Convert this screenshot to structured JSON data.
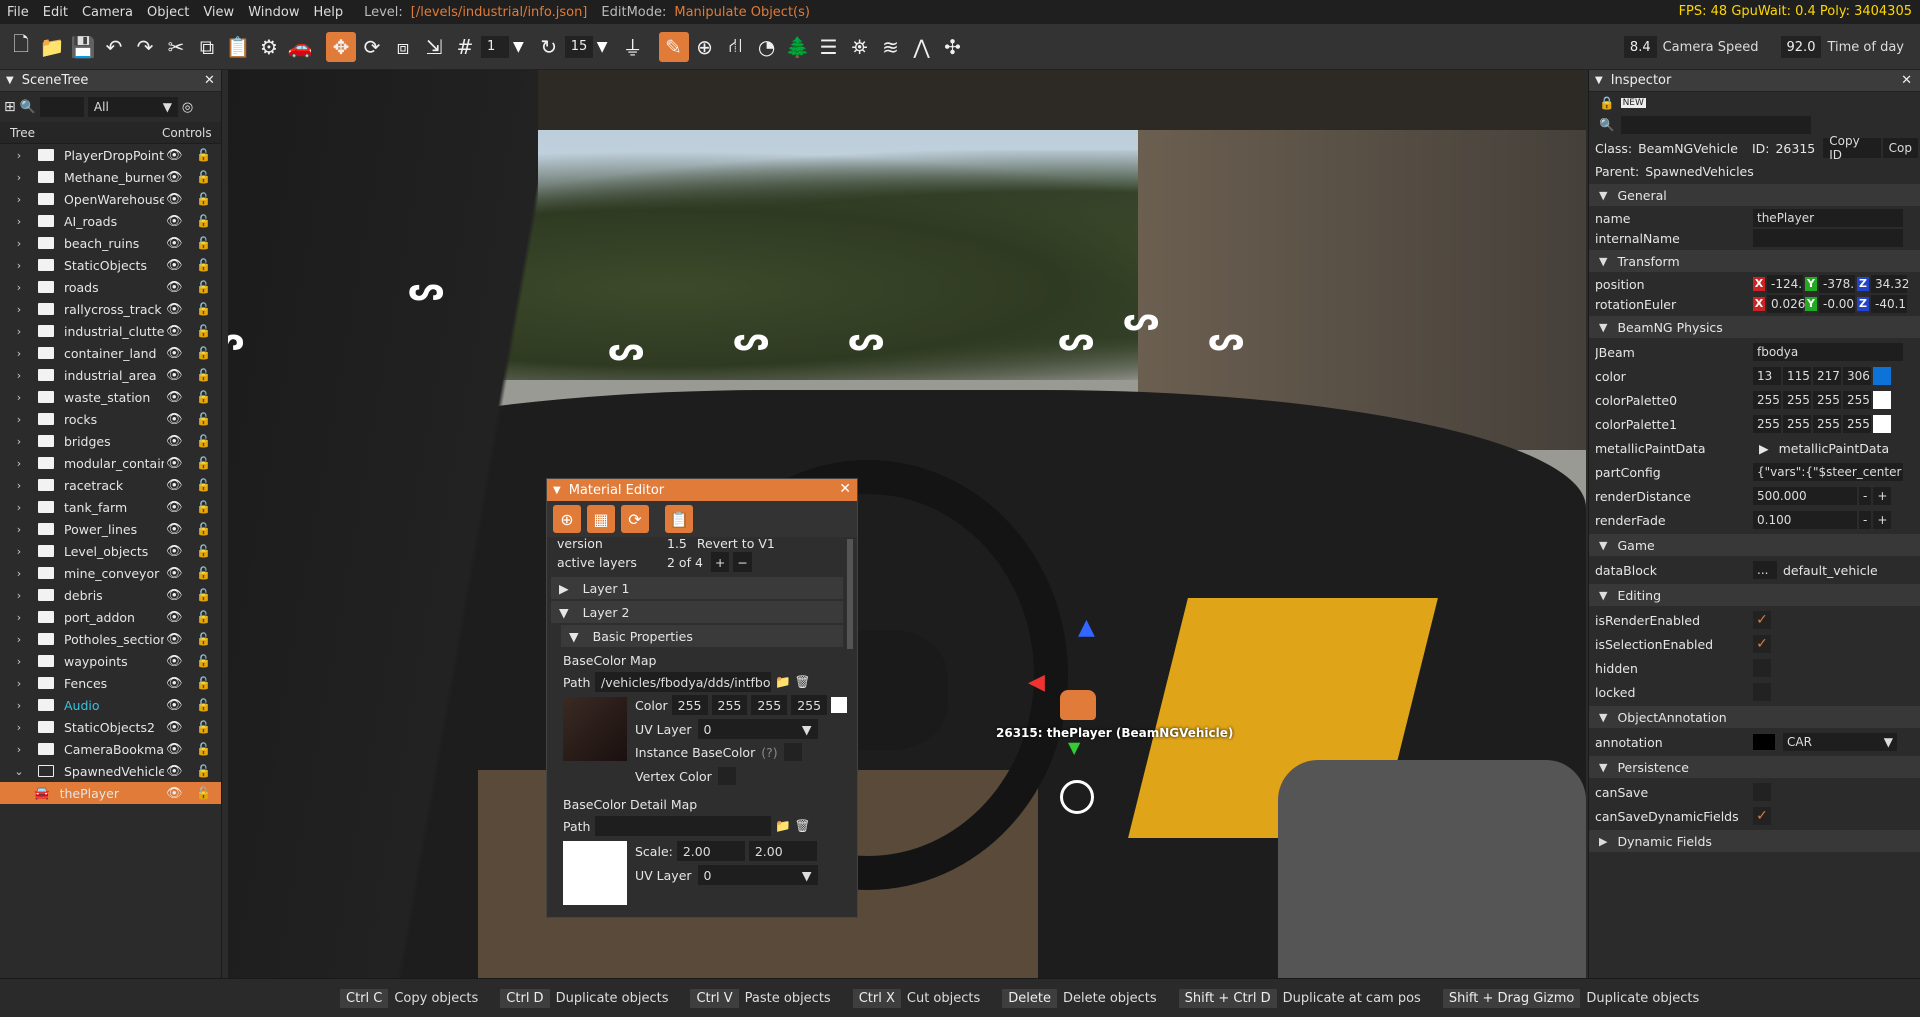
{
  "menu": {
    "items": [
      "File",
      "Edit",
      "Camera",
      "Object",
      "View",
      "Window",
      "Help"
    ],
    "level_label": "Level:",
    "level_path": "[/levels/industrial/info.json]",
    "editmode_label": "EditMode:",
    "editmode_value": "Manipulate Object(s)",
    "stats": "FPS: 48  GpuWait: 0.4  Poly: 3404305"
  },
  "toolbar": {
    "snap_value1": "1",
    "snap_value2": "15",
    "slider_value": "8.4",
    "camera_speed_label": "Camera Speed",
    "camera_speed_value": "92.0",
    "time_of_day_label": "Time of day"
  },
  "scenetree": {
    "title": "SceneTree",
    "filter": "All",
    "col_tree": "Tree",
    "col_controls": "Controls",
    "items": [
      {
        "label": "PlayerDropPoints"
      },
      {
        "label": "Methane_burner"
      },
      {
        "label": "OpenWarehouse"
      },
      {
        "label": "AI_roads"
      },
      {
        "label": "beach_ruins"
      },
      {
        "label": "StaticObjects"
      },
      {
        "label": "roads"
      },
      {
        "label": "rallycross_track"
      },
      {
        "label": "industrial_clutter"
      },
      {
        "label": "container_land"
      },
      {
        "label": "industrial_area"
      },
      {
        "label": "waste_station"
      },
      {
        "label": "rocks"
      },
      {
        "label": "bridges"
      },
      {
        "label": "modular_contain"
      },
      {
        "label": "racetrack"
      },
      {
        "label": "tank_farm"
      },
      {
        "label": "Power_lines"
      },
      {
        "label": "Level_objects"
      },
      {
        "label": "mine_conveyor"
      },
      {
        "label": "debris"
      },
      {
        "label": "port_addon"
      },
      {
        "label": "Potholes_section"
      },
      {
        "label": "waypoints"
      },
      {
        "label": "Fences"
      },
      {
        "label": "Audio"
      },
      {
        "label": "StaticObjects2"
      },
      {
        "label": "CameraBookmar"
      },
      {
        "label": "SpawnedVehicles"
      }
    ],
    "selected": "thePlayer"
  },
  "viewport": {
    "vehicle_label": "26315: thePlayer (BeamNGVehicle)"
  },
  "material_editor": {
    "title": "Material Editor",
    "version_label": "version",
    "version_value": "1.5",
    "revert_label": "Revert to V1",
    "active_layers_label": "active layers",
    "active_layers_value": "2 of 4",
    "layer1": "Layer 1",
    "layer2": "Layer 2",
    "basic_props": "Basic Properties",
    "basecolor_map": "BaseColor Map",
    "path_label": "Path",
    "path_value": "/vehicles/fbodya/dds/intfbody",
    "color_label": "Color",
    "color_values": [
      "255",
      "255",
      "255",
      "255"
    ],
    "uv_layer_label": "UV Layer",
    "uv_layer_value": "0",
    "instance_basecolor": "Instance BaseColor",
    "help_mark": "(?)",
    "vertex_color": "Vertex Color",
    "detail_map": "BaseColor Detail Map",
    "detail_path_label": "Path",
    "scale_label": "Scale:",
    "scale_values": [
      "2.00",
      "2.00"
    ],
    "detail_uv_label": "UV Layer",
    "detail_uv_value": "0"
  },
  "inspector": {
    "title": "Inspector",
    "class_label": "Class:",
    "class_value": "BeamNGVehicle",
    "id_label": "ID:",
    "id_value": "26315",
    "copy_id": "Copy ID",
    "copy_trunc": "Cop",
    "parent_label": "Parent:",
    "parent_value": "SpawnedVehicles",
    "sections": {
      "general": "General",
      "transform": "Transform",
      "physics": "BeamNG Physics",
      "game": "Game",
      "editing": "Editing",
      "annotation": "ObjectAnnotation",
      "persistence": "Persistence",
      "dynamic": "Dynamic Fields"
    },
    "name_label": "name",
    "name_value": "thePlayer",
    "internal_name_label": "internalName",
    "position_label": "position",
    "position": [
      "-124.",
      "-378.",
      "34.32"
    ],
    "rotation_label": "rotationEuler",
    "rotation": [
      "0.026",
      "-0.00",
      "-40.1"
    ],
    "jbeam_label": "JBeam",
    "jbeam_value": "fbodya",
    "color_label": "color",
    "color_values": [
      "13",
      "115",
      "217",
      "306"
    ],
    "palette0_label": "colorPalette0",
    "palette0": [
      "255",
      "255",
      "255",
      "255"
    ],
    "palette1_label": "colorPalette1",
    "palette1": [
      "255",
      "255",
      "255",
      "255"
    ],
    "metallic_label": "metallicPaintData",
    "metallic_value": "metallicPaintData",
    "partconfig_label": "partConfig",
    "partconfig_value": "{\"vars\":{\"$steer_center",
    "renderdist_label": "renderDistance",
    "renderdist_value": "500.000",
    "renderfade_label": "renderFade",
    "renderfade_value": "0.100",
    "datablock_label": "dataBlock",
    "datablock_btn": "...",
    "datablock_value": "default_vehicle",
    "render_enabled_label": "isRenderEnabled",
    "selection_enabled_label": "isSelectionEnabled",
    "hidden_label": "hidden",
    "locked_label": "locked",
    "annotation_label": "annotation",
    "annotation_value": "CAR",
    "cansave_label": "canSave",
    "cansavedyn_label": "canSaveDynamicFields"
  },
  "statusbar": [
    {
      "key": "Ctrl C",
      "action": "Copy objects"
    },
    {
      "key": "Ctrl D",
      "action": "Duplicate objects"
    },
    {
      "key": "Ctrl V",
      "action": "Paste objects"
    },
    {
      "key": "Ctrl X",
      "action": "Cut objects"
    },
    {
      "key": "Delete",
      "action": "Delete objects"
    },
    {
      "key": "Shift + Ctrl D",
      "action": "Duplicate at cam pos"
    },
    {
      "key": "Shift + Drag Gizmo",
      "action": "Duplicate objects"
    }
  ],
  "colors": {
    "accent": "#e07b39",
    "vehicle_color": "#0d73d9"
  }
}
